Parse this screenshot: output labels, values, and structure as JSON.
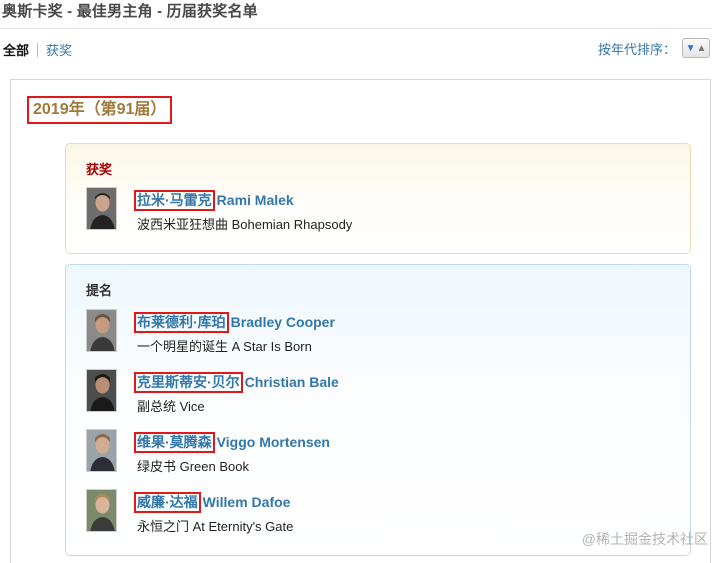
{
  "page": {
    "title": "奥斯卡奖 - 最佳男主角 - 历届获奖名单"
  },
  "filters": {
    "all": "全部",
    "won": "获奖"
  },
  "sort": {
    "label": "按年代排序："
  },
  "year": {
    "heading": "2019年（第91届）"
  },
  "winner": {
    "label": "获奖",
    "person": {
      "cn": "拉米·马雷克",
      "en": "Rami Malek",
      "film": "波西米亚狂想曲 Bohemian Rhapsody"
    }
  },
  "nominees": {
    "label": "提名",
    "items": [
      {
        "cn": "布莱德利·库珀",
        "en": "Bradley Cooper",
        "film": "一个明星的诞生 A Star Is Born"
      },
      {
        "cn": "克里斯蒂安·贝尔",
        "en": "Christian Bale",
        "film": "副总统 Vice"
      },
      {
        "cn": "维果·莫腾森",
        "en": "Viggo Mortensen",
        "film": "绿皮书 Green Book"
      },
      {
        "cn": "威廉·达福",
        "en": "Willem Dafoe",
        "film": "永恒之门 At Eternity's Gate"
      }
    ]
  },
  "watermark": "@稀土掘金技术社区",
  "colors": {
    "link": "#3377aa",
    "highlight_box": "#e01818",
    "year_text": "#a07a38",
    "winner_label": "#a50000"
  },
  "icons": {
    "sort": "sort-toggle-icon"
  }
}
